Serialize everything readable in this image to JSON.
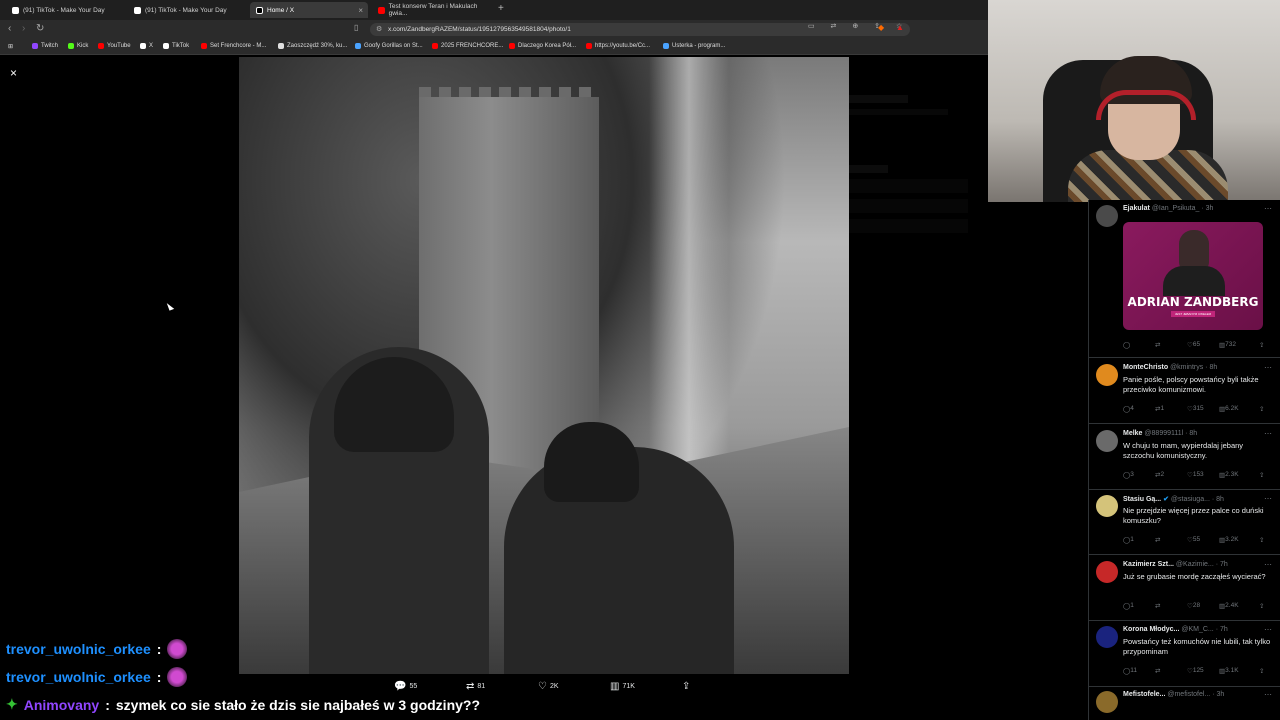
{
  "browser": {
    "tabs": [
      {
        "title": "(91) TikTok - Make Your Day",
        "icon": "tiktok-icon"
      },
      {
        "title": "(91) TikTok - Make Your Day",
        "icon": "tiktok-icon"
      },
      {
        "title": "Home / X",
        "icon": "x-icon",
        "active": true
      },
      {
        "title": "Test konserw Teran i Makulach gwia...",
        "icon": "youtube-icon"
      }
    ],
    "new_tab": "+",
    "close_tab": "×",
    "url": "x.com/ZandbergRAZEM/status/1951279563549581804/photo/1",
    "bookmarks": [
      {
        "label": "Twitch",
        "color": "#9146ff"
      },
      {
        "label": "Kick",
        "color": "#53fc18"
      },
      {
        "label": "YouTube",
        "color": "#ff0000"
      },
      {
        "label": "X",
        "color": "#ffffff"
      },
      {
        "label": "TikTok",
        "color": "#ffffff"
      },
      {
        "label": "Set Frenchcore - M...",
        "color": "#ff0000"
      },
      {
        "label": "Zaoszczędź 30%, ku...",
        "color": "#e0e0e0"
      },
      {
        "label": "Goofy Gorillas on St...",
        "color": "#4aa3ff"
      },
      {
        "label": "2025 FRENCHCORE...",
        "color": "#ff0000"
      },
      {
        "label": "Dlaczego Korea Pół...",
        "color": "#ff0000"
      },
      {
        "label": "https://youtu.be/Cc...",
        "color": "#ff0000"
      },
      {
        "label": "Usterka - program...",
        "color": "#4aa3ff"
      }
    ]
  },
  "viewer": {
    "close": "×",
    "actions": {
      "replies": "55",
      "reposts": "81",
      "likes": "2K",
      "views": "71K"
    }
  },
  "replies": [
    {
      "name": "Ejakulat",
      "handle": "@Ian_Psikuta_ · 3h",
      "text": "",
      "promo_title": "ADRIAN ZANDBERG",
      "promo_sub": "JEST JEBANYM CWELEM",
      "likes": "65",
      "views": "732",
      "reposts": "",
      "replies": "",
      "avatar_color": "#4a4a4a"
    },
    {
      "name": "MonteChristo",
      "handle": "@kmintrys · 8h",
      "text": "Panie pośle, polscy powstańcy byli także przeciwko komunizmowi.",
      "replies": "4",
      "reposts": "1",
      "likes": "315",
      "views": "6.2K",
      "avatar_color": "#e08a1e"
    },
    {
      "name": "Melke",
      "handle": "@88999111l · 8h",
      "text": "W chuju to mam, wypierdalaj jebany szczochu komunistyczny.",
      "replies": "3",
      "reposts": "2",
      "likes": "153",
      "views": "2.3K",
      "avatar_color": "#6a6a6a"
    },
    {
      "name": "Stasiu Gą...",
      "handle": "@stasiuga... · 8h",
      "text": "Nie przejdzie więcej przez palce co duński komuszku?",
      "replies": "1",
      "reposts": "",
      "likes": "55",
      "views": "3.2K",
      "avatar_color": "#d4c37a"
    },
    {
      "name": "Kazimierz Szt...",
      "handle": "@Kazimie... · 7h",
      "text": "Już se grubasie mordę zacząłeś wycierać?",
      "replies": "1",
      "reposts": "",
      "likes": "28",
      "views": "2.4K",
      "avatar_color": "#c62828"
    },
    {
      "name": "Korona Młodyc...",
      "handle": "@KM_C... · 7h",
      "text": "Powstańcy też komuchów nie lubili, tak tylko przypominam",
      "replies": "11",
      "reposts": "",
      "likes": "125",
      "views": "3.1K",
      "avatar_color": "#1a237e"
    },
    {
      "name": "Mefistofele...",
      "handle": "@mefistofel... · 3h",
      "text": "",
      "avatar_color": "#8a6a2a"
    }
  ],
  "chat": [
    {
      "user": "trevor_uwolnic_orkee",
      "color": "#1e90ff",
      "emote": true,
      "message": ""
    },
    {
      "user": "trevor_uwolnic_orkee",
      "color": "#1e90ff",
      "emote": true,
      "message": ""
    },
    {
      "user": "Animovany",
      "color": "#9146ff",
      "badge": "✦",
      "message": "szymek co sie stało że dzis sie najbałeś w 3 godziny??"
    }
  ],
  "colors": {
    "background": "#000000",
    "text": "#e7e9ea",
    "muted": "#71767b",
    "chrome": "#2b2b2b"
  }
}
